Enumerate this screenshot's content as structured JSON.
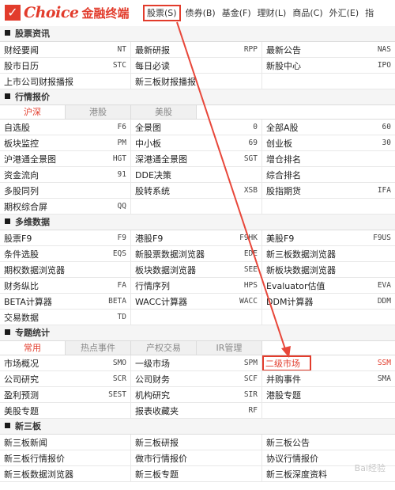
{
  "app": {
    "logo_text": "Choice",
    "logo_sub": "金融终端",
    "logo_check": "✓"
  },
  "menu": [
    {
      "label": "股票(S)",
      "active": true
    },
    {
      "label": "债券(B)"
    },
    {
      "label": "基金(F)"
    },
    {
      "label": "理财(L)"
    },
    {
      "label": "商品(C)"
    },
    {
      "label": "外汇(E)"
    },
    {
      "label": "指"
    }
  ],
  "sections": [
    {
      "title": "股票资讯",
      "rows": [
        [
          [
            "财经要闻",
            "NT"
          ],
          [
            "最新研报",
            "RPP"
          ],
          [
            "最新公告",
            "NAS"
          ]
        ],
        [
          [
            "股市日历",
            "STC"
          ],
          [
            "每日必读",
            ""
          ],
          [
            "新股中心",
            "IPO"
          ]
        ],
        [
          [
            "上市公司财报播报",
            ""
          ],
          [
            "新三板财报播报",
            ""
          ],
          [
            "",
            ""
          ]
        ]
      ]
    },
    {
      "title": "行情报价",
      "tabs": [
        "沪深",
        "港股",
        "美股"
      ],
      "rows": [
        [
          [
            "自选股",
            "F6"
          ],
          [
            "全景图",
            "0"
          ],
          [
            "全部A股",
            "60"
          ]
        ],
        [
          [
            "板块监控",
            "PM"
          ],
          [
            "中小板",
            "69"
          ],
          [
            "创业板",
            "30"
          ]
        ],
        [
          [
            "沪港通全景图",
            "HGT"
          ],
          [
            "深港通全景图",
            "SGT"
          ],
          [
            "增仓排名",
            ""
          ]
        ],
        [
          [
            "资金流向",
            "91"
          ],
          [
            "DDE决策",
            ""
          ],
          [
            "综合排名",
            ""
          ]
        ],
        [
          [
            "多股同列",
            ""
          ],
          [
            "股转系统",
            "XSB"
          ],
          [
            "股指期货",
            "IFA"
          ]
        ],
        [
          [
            "期权综合屏",
            "QQ"
          ],
          [
            "",
            ""
          ],
          [
            "",
            ""
          ]
        ]
      ]
    },
    {
      "title": "多维数据",
      "rows": [
        [
          [
            "股票F9",
            "F9"
          ],
          [
            "港股F9",
            "F9HK"
          ],
          [
            "美股F9",
            "F9US"
          ]
        ],
        [
          [
            "条件选股",
            "EQS"
          ],
          [
            "新股票数据浏览器",
            "EDE"
          ],
          [
            "新三板数据浏览器",
            ""
          ]
        ],
        [
          [
            "期权数据浏览器",
            ""
          ],
          [
            "板块数据浏览器",
            "SEE"
          ],
          [
            "新板块数据浏览器",
            ""
          ]
        ],
        [
          [
            "财务纵比",
            "FA"
          ],
          [
            "行情序列",
            "HPS"
          ],
          [
            "Evaluator估值",
            "EVA"
          ]
        ],
        [
          [
            "BETA计算器",
            "BETA"
          ],
          [
            "WACC计算器",
            "WACC"
          ],
          [
            "DDM计算器",
            "DDM"
          ]
        ],
        [
          [
            "交易数据",
            "TD"
          ],
          [
            "",
            ""
          ],
          [
            "",
            ""
          ]
        ]
      ]
    },
    {
      "title": "专题统计",
      "tabs": [
        "常用",
        "热点事件",
        "产权交易",
        "IR管理"
      ],
      "rows": [
        [
          [
            "市场概况",
            "SMO"
          ],
          [
            "一级市场",
            "SPM"
          ],
          [
            "二级市场",
            "SSM"
          ]
        ],
        [
          [
            "公司研究",
            "SCR"
          ],
          [
            "公司财务",
            "SCF"
          ],
          [
            "并购事件",
            "SMA"
          ]
        ],
        [
          [
            "盈利预测",
            "SEST"
          ],
          [
            "机构研究",
            "SIR"
          ],
          [
            "港股专题",
            ""
          ]
        ],
        [
          [
            "美股专题",
            ""
          ],
          [
            "报表收藏夹",
            "RF"
          ],
          [
            "",
            ""
          ]
        ]
      ]
    },
    {
      "title": "新三板",
      "rows": [
        [
          [
            "新三板新闻",
            ""
          ],
          [
            "新三板研报",
            ""
          ],
          [
            "新三板公告",
            ""
          ]
        ],
        [
          [
            "新三板行情报价",
            ""
          ],
          [
            "做市行情报价",
            ""
          ],
          [
            "协议行情报价",
            ""
          ]
        ],
        [
          [
            "新三板数据浏览器",
            ""
          ],
          [
            "新三板专题",
            ""
          ],
          [
            "新三板深度资料",
            ""
          ]
        ]
      ]
    }
  ],
  "colors": {
    "accent": "#e23c2c"
  }
}
